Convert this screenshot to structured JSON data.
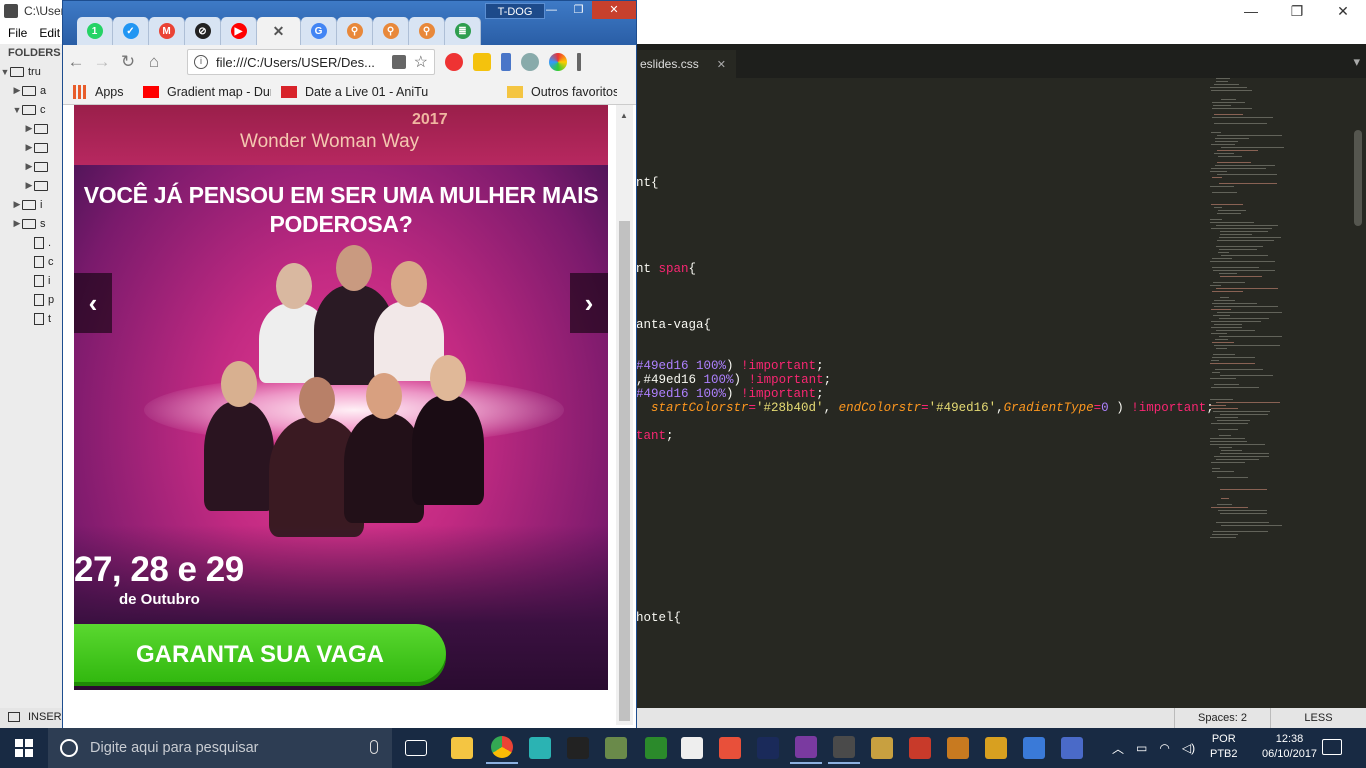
{
  "sublime": {
    "title": "C:\\Users",
    "window_controls": [
      "—",
      "❐",
      "✕"
    ],
    "menu": [
      "File",
      "Edit"
    ],
    "sidebar": {
      "header": "FOLDERS",
      "items": [
        {
          "label": "tru",
          "type": "folder",
          "open": true
        },
        {
          "label": "a",
          "type": "folder",
          "open": false
        },
        {
          "label": "c",
          "type": "folder",
          "open": true
        },
        {
          "label": "",
          "type": "folder",
          "open": false
        },
        {
          "label": "",
          "type": "folder",
          "open": false
        },
        {
          "label": "",
          "type": "folder",
          "open": false
        },
        {
          "label": "",
          "type": "folder",
          "open": false
        },
        {
          "label": "i",
          "type": "folder",
          "open": false
        },
        {
          "label": "s",
          "type": "folder",
          "open": false
        },
        {
          "label": ".",
          "type": "file"
        },
        {
          "label": "c",
          "type": "file"
        },
        {
          "label": "i",
          "type": "file"
        },
        {
          "label": "p",
          "type": "file"
        },
        {
          "label": "t",
          "type": "file"
        }
      ]
    },
    "tab": {
      "label": "eslides.css",
      "close": "✕"
    },
    "tab_more": "▾",
    "status": {
      "mode": "INSER",
      "spaces": "Spaces: 2",
      "syntax": "LESS"
    },
    "code_lines": [
      {
        "parts": [
          {
            "t": "nt{",
            "c": "sl"
          }
        ]
      },
      {
        "parts": [
          {
            "t": "nt ",
            "c": "sl"
          },
          {
            "t": "span",
            "c": "kw"
          },
          {
            "t": "{",
            "c": "sl"
          }
        ]
      },
      {
        "parts": [
          {
            "t": "anta-vaga{",
            "c": "sl"
          }
        ]
      },
      {
        "parts": [
          {
            "t": "#49ed16 ",
            "c": "nm"
          },
          {
            "t": "100%",
            "c": "nm"
          },
          {
            "t": ") ",
            "c": "sl"
          },
          {
            "t": "!important",
            "c": "kw"
          },
          {
            "t": ";",
            "c": "sl"
          }
        ]
      },
      {
        "parts": [
          {
            "t": ",",
            "c": "sl"
          },
          {
            "t": "#49ed16 ",
            "c": "sl"
          },
          {
            "t": "100%",
            "c": "nm"
          },
          {
            "t": ") ",
            "c": "sl"
          },
          {
            "t": "!important",
            "c": "kw"
          },
          {
            "t": ";",
            "c": "sl"
          }
        ]
      },
      {
        "parts": [
          {
            "t": "#49ed16 ",
            "c": "nm"
          },
          {
            "t": "100%",
            "c": "nm"
          },
          {
            "t": ") ",
            "c": "sl"
          },
          {
            "t": "!important",
            "c": "kw"
          },
          {
            "t": ";",
            "c": "sl"
          }
        ]
      },
      {
        "parts": [
          {
            "t": "  startColorstr",
            "c": "it"
          },
          {
            "t": "=",
            "c": "kw"
          },
          {
            "t": "'#28b40d'",
            "c": "st"
          },
          {
            "t": ", ",
            "c": "sl"
          },
          {
            "t": "endColorstr",
            "c": "it"
          },
          {
            "t": "=",
            "c": "kw"
          },
          {
            "t": "'#49ed16'",
            "c": "st"
          },
          {
            "t": ",",
            "c": "sl"
          },
          {
            "t": "GradientType",
            "c": "it"
          },
          {
            "t": "=",
            "c": "kw"
          },
          {
            "t": "0",
            "c": "nm"
          },
          {
            "t": " ) ",
            "c": "sl"
          },
          {
            "t": "!important",
            "c": "kw"
          },
          {
            "t": ";",
            "c": "sl"
          }
        ]
      },
      {
        "parts": [
          {
            "t": "tant",
            "c": "kw"
          },
          {
            "t": ";",
            "c": "sl"
          }
        ]
      },
      {
        "parts": [
          {
            "t": "hotel{",
            "c": "sl"
          }
        ]
      }
    ]
  },
  "chrome": {
    "user": "T-DOG",
    "window_controls": [
      "—",
      "❐",
      "✕"
    ],
    "tabs": [
      {
        "icon": "whatsapp-icon",
        "color": "#25d366",
        "glyph": "1"
      },
      {
        "icon": "check-icon",
        "color": "#2196f3",
        "glyph": "✓"
      },
      {
        "icon": "gmail-icon",
        "color": "#ea4335",
        "glyph": "M"
      },
      {
        "icon": "tool-icon",
        "color": "#222222",
        "glyph": "⊘"
      },
      {
        "icon": "youtube-icon",
        "color": "#ff0000",
        "glyph": "▶"
      },
      {
        "icon": "close-icon",
        "color": "#555555",
        "glyph": "✕",
        "active": true
      },
      {
        "icon": "google-icon",
        "color": "#4285f4",
        "glyph": "G"
      },
      {
        "icon": "link-icon",
        "color": "#e8883a",
        "glyph": "⚲"
      },
      {
        "icon": "link-icon",
        "color": "#e8883a",
        "glyph": "⚲"
      },
      {
        "icon": "link-icon",
        "color": "#e8883a",
        "glyph": "⚲"
      },
      {
        "icon": "stack-icon",
        "color": "#2e9e4f",
        "glyph": "≣"
      }
    ],
    "url": "file:///C:/Users/USER/Des...",
    "bookmarks": [
      {
        "label": "Apps",
        "icon": "apps-icon",
        "color": "#e85d2b"
      },
      {
        "label": "Gradient map - Durac",
        "icon": "youtube-icon",
        "color": "#ff0000"
      },
      {
        "label": "Date a Live 01 - AniTu",
        "icon": "anitube-icon",
        "color": "#d8232a"
      },
      {
        "label": "Outros favoritos",
        "icon": "folder-icon",
        "color": "#f4c542"
      }
    ],
    "page": {
      "year": "2017",
      "brand": "Wonder Woman Way",
      "headline_1": "VOCÊ JÁ PENSOU EM SER UMA MULHER MAIS",
      "headline_2": "PODEROSA?",
      "dates": "27, 28 e 29",
      "month": "de Outubro",
      "cta": "GARANTA SUA VAGA",
      "prev": "‹",
      "next": "›"
    }
  },
  "taskbar": {
    "search_placeholder": "Digite aqui para pesquisar",
    "apps": [
      "task-view",
      "file-explorer",
      "chrome",
      "maya",
      "epic-games",
      "minecraft",
      "vim",
      "zbrush",
      "sublime-red",
      "photoshop",
      "photoshop-purple",
      "sublime",
      "league",
      "game-a",
      "game-b",
      "game-c",
      "xnview",
      "screen"
    ],
    "lang_1": "POR",
    "lang_2": "PTB2",
    "time": "12:38",
    "date": "06/10/2017"
  }
}
